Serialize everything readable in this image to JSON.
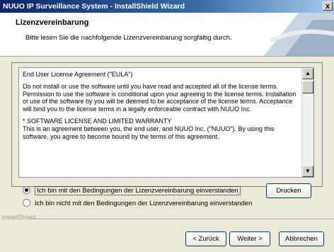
{
  "window": {
    "title": "NUUO IP Surveillance System - InstallShield Wizard",
    "close_glyph": "x"
  },
  "header": {
    "title": "Lizenzvereinbarung",
    "subtitle": "Bitte lesen Sie die nachfolgende Lizenzvereinbarung sorgfältig durch."
  },
  "license": {
    "paragraphs": [
      "End User License Agreement (\"EULA\")",
      "Do not install or use the software until you have read and accepted all of the license terms. Permission to use the software is conditional upon your agreeing to the license terms. Installation or use of the software by you will be deemed to be acceptance of the license terms. Acceptance will bind you to the license terms in a legally enforceable contract with NUUO Inc.",
      "* SOFTWARE LICENSE AND LIMITED WARRANTY",
      "This is an agreement between you, the end user, and NUUO Inc. (\"NUUO\"). By using this software, you agree to become bound by the terms of this agreement."
    ]
  },
  "options": {
    "accept_label": "Ich bin mit den Bedingungen der Lizenzvereinbarung einverstanden",
    "decline_label": "Ich bin nicht mit den Bedingungen der Lizenzvereinbarung einverstanden",
    "selected": "accept"
  },
  "buttons": {
    "print": "Drucken",
    "back": "< Zurück",
    "next": "Weiter >",
    "cancel": "Abbrechen"
  },
  "footer": {
    "brand": "InstallShield"
  }
}
